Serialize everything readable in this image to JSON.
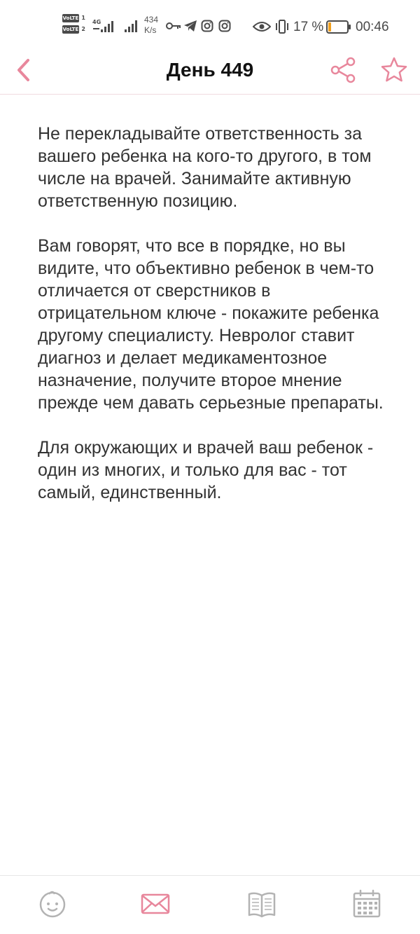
{
  "status_bar": {
    "volte1": "VoLTE",
    "sim1": "1",
    "volte2": "VoLTE",
    "sim2": "2",
    "network_type": "4G",
    "net_speed_value": "434",
    "net_speed_unit": "K/s",
    "battery_percent": "17 %",
    "battery_level": 0.17,
    "time": "00:46",
    "icons": [
      "key-icon",
      "telegram-icon",
      "instagram-icon",
      "instagram-icon",
      "eye-icon",
      "vibrate-icon",
      "battery-icon"
    ]
  },
  "header": {
    "title": "День 449",
    "accent_color": "#e8879c",
    "icons": [
      "chevron-left-icon",
      "share-icon",
      "star-icon"
    ]
  },
  "content": {
    "paragraphs": [
      "Не перекладывайте ответственность за вашего ребенка на кого-то другого, в том числе на врачей. Занимайте активную ответственную позицию.",
      "Вам говорят, что все в порядке, но вы видите, что объективно ребенок в чем-то отличается от сверстников в отрицательном ключе - покажите ребенка другому специалисту. Невролог ставит диагноз и делает медикаментозное назначение, получите второе мнение прежде чем давать серьезные препараты.",
      "Для окружающих и врачей ваш ребенок - один из многих, и только для вас - тот самый, единственный."
    ]
  },
  "bottom_nav": {
    "items": [
      {
        "icon": "baby-icon",
        "active": false
      },
      {
        "icon": "mail-icon",
        "active": true
      },
      {
        "icon": "book-icon",
        "active": false
      },
      {
        "icon": "calendar-icon",
        "active": false
      }
    ],
    "active_color": "#e8879c",
    "inactive_color": "#b3b3b3"
  }
}
